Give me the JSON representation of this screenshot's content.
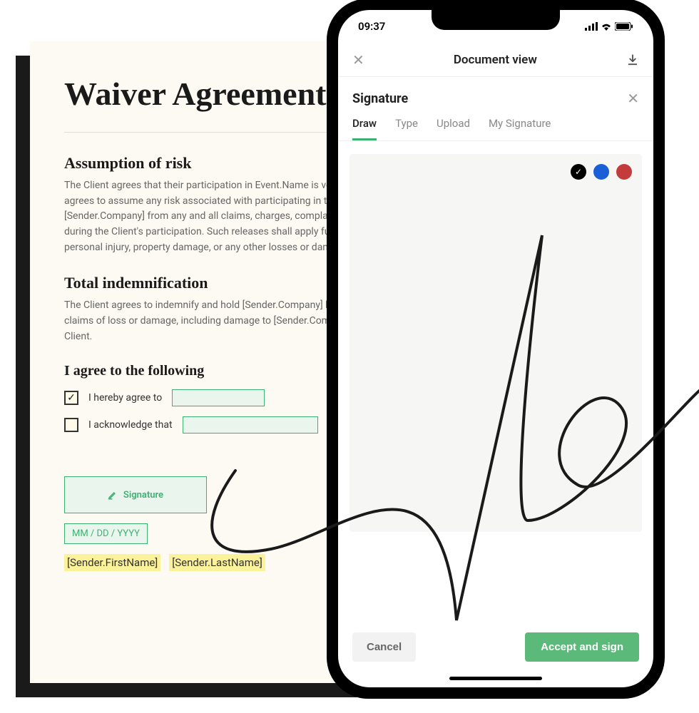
{
  "document": {
    "title": "Waiver Agreement",
    "sections": {
      "assumption": {
        "heading": "Assumption of risk",
        "body": "The Client agrees that their participation in Event.Name is voluntary. Further, the Client agrees to assume any risk associated with participating in the event, and releases [Sender.Company] from any and all claims, charges, complaints, or lawsuits that may arise during the Client's participation. Such releases shall apply fully and include attorneys' fees, personal injury, property damage, or any other losses or damages suffered by the Client."
      },
      "indemnification": {
        "heading": "Total indemnification",
        "body": "The Client agrees to indemnify and hold [Sender.Company] harmless from any and all claims of loss or damage, including damage to [Sender.Company] property caused by the Client."
      },
      "agree": {
        "heading": "I agree to the following",
        "items": [
          {
            "label": "I hereby agree to",
            "checked": true
          },
          {
            "label": "I acknowledge that",
            "checked": false
          }
        ]
      }
    },
    "signature_button": "Signature",
    "date_placeholder": "MM / DD / YYYY",
    "tokens": {
      "first": "[Sender.FirstName]",
      "last": "[Sender.LastName]"
    }
  },
  "phone": {
    "time": "09:37",
    "header": {
      "title": "Document view"
    },
    "signature_panel": {
      "title": "Signature",
      "tabs": [
        "Draw",
        "Type",
        "Upload",
        "My Signature"
      ],
      "active_tab": "Draw",
      "colors": {
        "black": "#000000",
        "blue": "#1a5fd6",
        "red": "#c43b3b",
        "selected": "black"
      },
      "cancel": "Cancel",
      "accept": "Accept and sign"
    }
  }
}
